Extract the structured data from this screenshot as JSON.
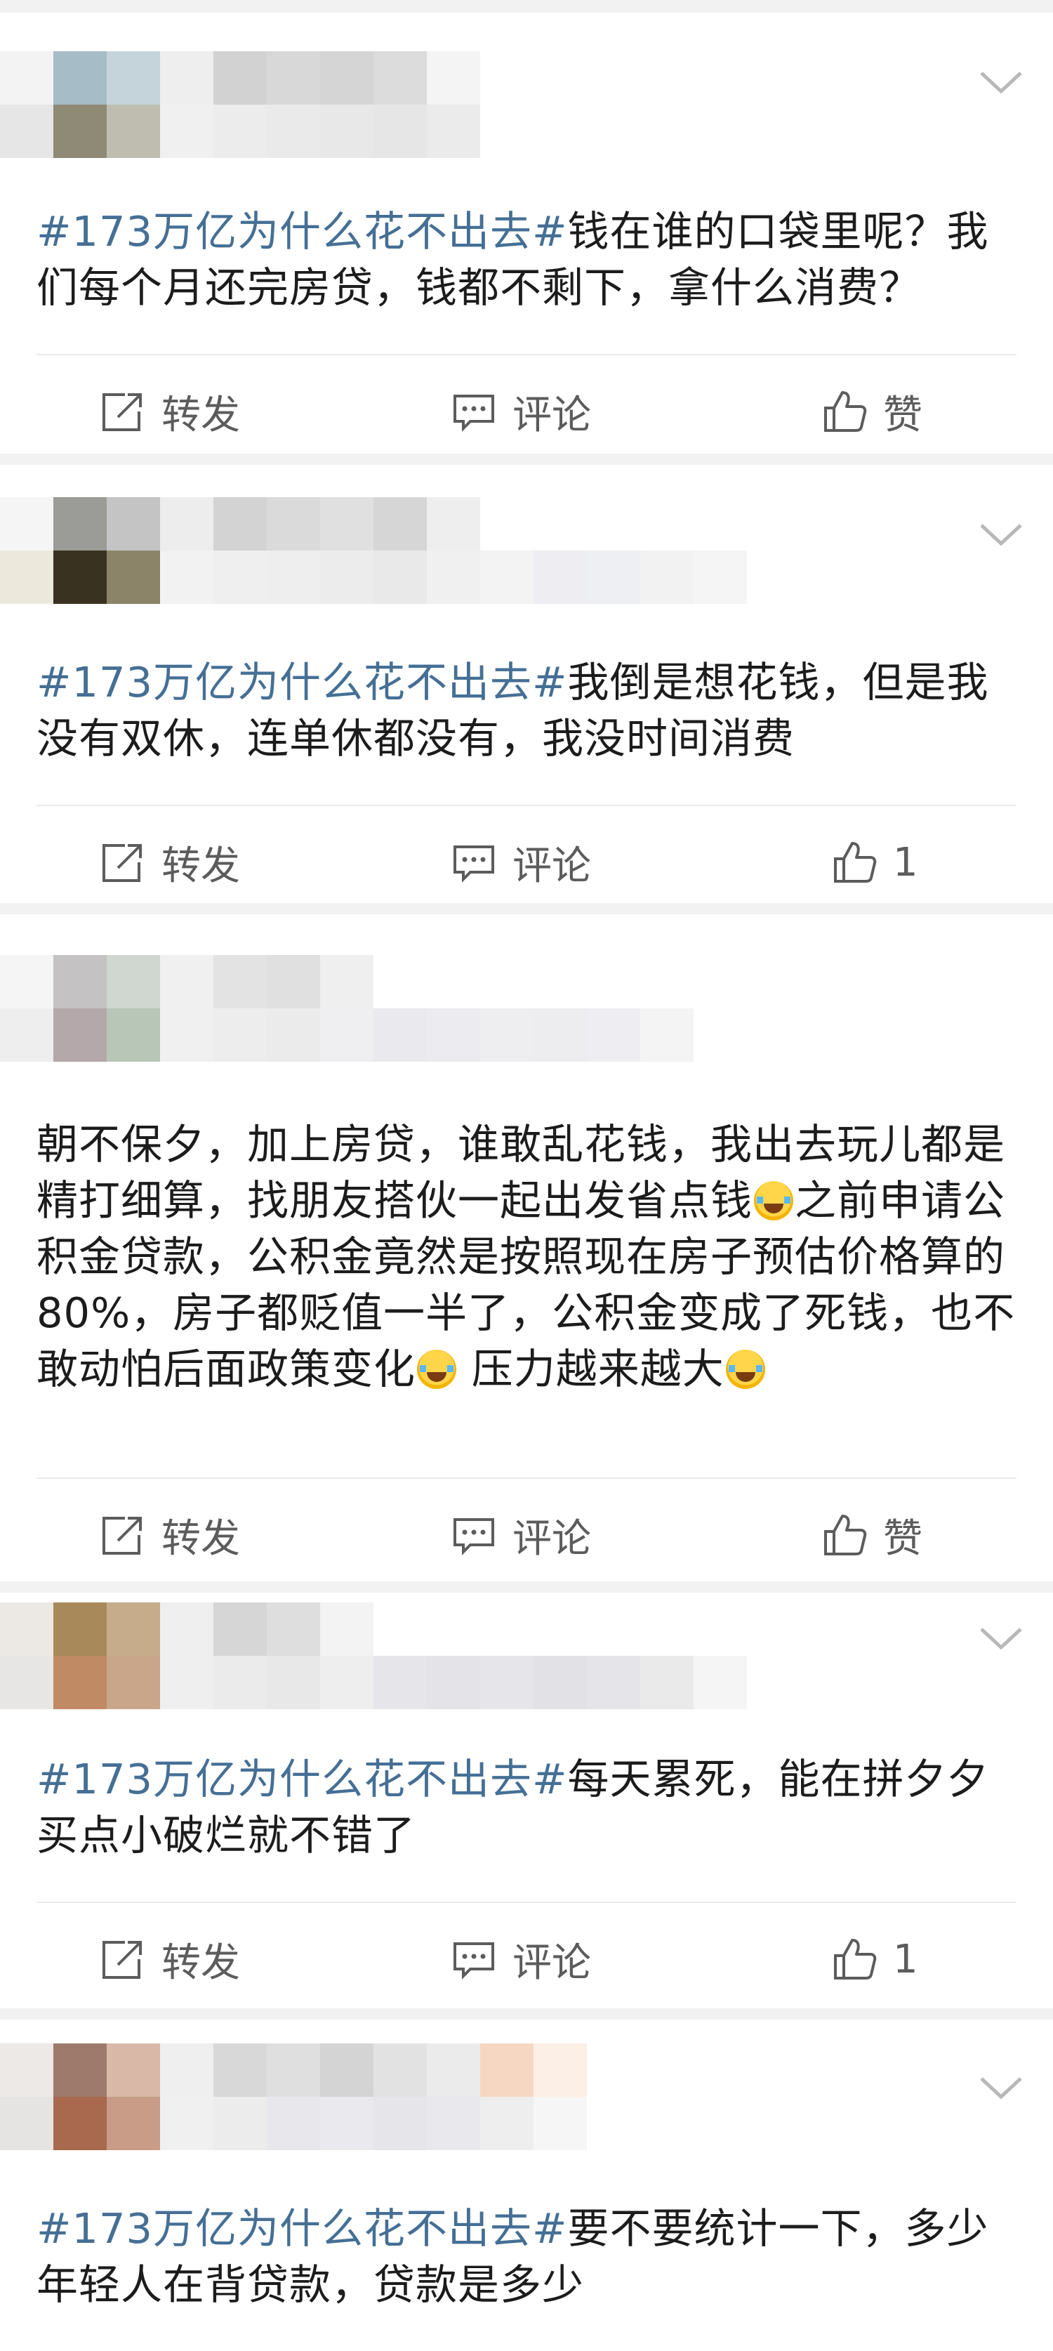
{
  "actions": {
    "repost_label": "转发",
    "comment_label": "评论"
  },
  "posts": [
    {
      "topic": "#173万亿为什么花不出去#",
      "body": "钱在谁的口袋里呢？我们每个月还完房贷，钱都不剩下，拿什么消费？",
      "like_label": "赞"
    },
    {
      "topic": "#173万亿为什么花不出去#",
      "body": "我倒是想花钱，但是我没有双休，连单休都没有，我没时间消费",
      "like_label": "1"
    },
    {
      "body_part1": "朝不保夕，加上房贷，谁敢乱花钱，我出去玩儿都是精打细算，找朋友搭伙一起出发省点钱",
      "body_part2": "之前申请公积金贷款，公积金竟然是按照现在房子预估价格算的80%，房子都贬值一半了，公积金变成了死钱，也不敢动怕后面政策变化",
      "body_part3": " 压力越来越大",
      "emoji": "laughing-crying-emoji",
      "like_label": "赞"
    },
    {
      "topic": "#173万亿为什么花不出去#",
      "body": "每天累死，能在拼夕夕买点小破烂就不错了",
      "like_label": "1"
    },
    {
      "topic": "#173万亿为什么花不出去#",
      "body": "要不要统计一下，多少年轻人在背贷款，贷款是多少"
    }
  ],
  "icons": [
    "repost-icon",
    "comment-icon",
    "like-icon",
    "chevron-down-icon"
  ],
  "colors": {
    "topic": "#456f95",
    "text": "#1c1c1c",
    "action_text": "#5c5c5c",
    "background": "#f2f2f2"
  }
}
